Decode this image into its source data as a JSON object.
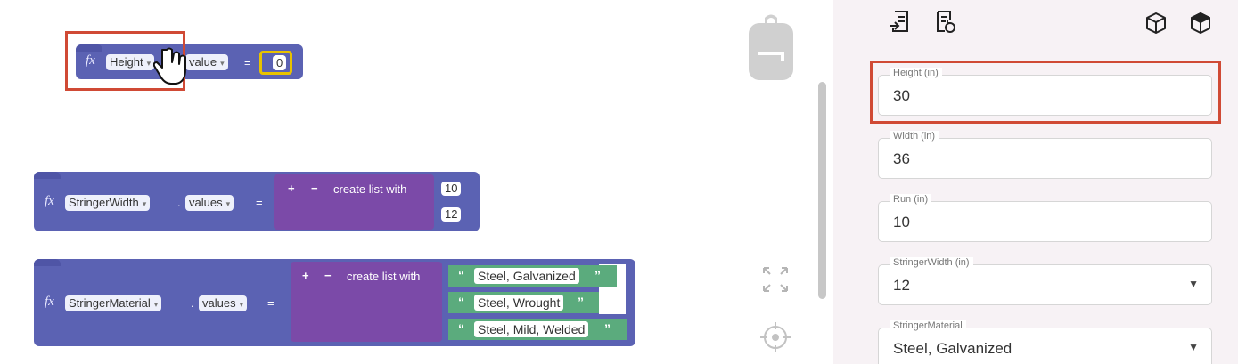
{
  "blocks": {
    "height": {
      "fx": "fx",
      "name": "Height",
      "prop": "value",
      "equals": "=",
      "value": "0"
    },
    "stringer_width": {
      "fx": "fx",
      "name": "StringerWidth",
      "dot": ".",
      "prop": "values",
      "equals": "=",
      "list_label": "create list with",
      "plus": "+",
      "minus": "−",
      "items": [
        "10",
        "12"
      ]
    },
    "stringer_material": {
      "fx": "fx",
      "name": "StringerMaterial",
      "dot": ".",
      "prop": "values",
      "equals": "=",
      "list_label": "create list with",
      "plus": "+",
      "minus": "−",
      "items": [
        "Steel, Galvanized",
        "Steel, Wrought",
        "Steel, Mild, Welded"
      ]
    },
    "open_quote": "“",
    "close_quote": "”"
  },
  "colors": {
    "block": "#5b62b3",
    "list_block": "#7b4aa8",
    "string_block": "#5bab7d",
    "number_outline": "#e8c200",
    "highlight": "#d04a35"
  },
  "panel": {
    "fields": [
      {
        "label": "Height (in)",
        "value": "30",
        "dropdown": false
      },
      {
        "label": "Width (in)",
        "value": "36",
        "dropdown": false
      },
      {
        "label": "Run (in)",
        "value": "10",
        "dropdown": false
      },
      {
        "label": "StringerWidth (in)",
        "value": "12",
        "dropdown": true
      },
      {
        "label": "StringerMaterial",
        "value": "Steel, Galvanized",
        "dropdown": true
      }
    ]
  },
  "icons": {
    "toolbar": [
      "export-rules-icon",
      "reset-rules-icon",
      "cube-outline-icon",
      "cube-filled-icon"
    ],
    "canvas": [
      "backpack-icon",
      "fit-view-icon",
      "center-target-icon"
    ]
  }
}
